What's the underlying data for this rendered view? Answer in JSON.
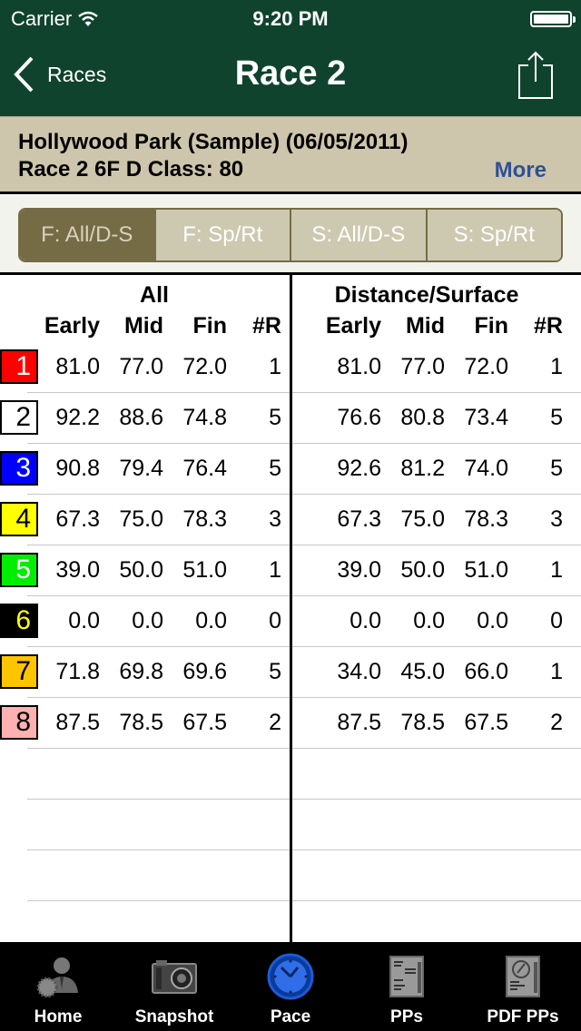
{
  "status_bar": {
    "carrier": "Carrier",
    "time": "9:20 PM"
  },
  "nav": {
    "back_label": "Races",
    "title": "Race 2"
  },
  "race_info": {
    "line1": "Hollywood Park (Sample) (06/05/2011)",
    "line2": "Race 2 6F D Class: 80",
    "more_label": "More"
  },
  "segments": [
    {
      "label": "F: All/D-S",
      "active": true
    },
    {
      "label": "F: Sp/Rt",
      "active": false
    },
    {
      "label": "S: All/D-S",
      "active": false
    },
    {
      "label": "S: Sp/Rt",
      "active": false
    }
  ],
  "table": {
    "groups": {
      "all": "All",
      "ds": "Distance/Surface"
    },
    "columns": [
      "Early",
      "Mid",
      "Fin",
      "#R"
    ],
    "rows": [
      {
        "pgm": "1",
        "bg": "#ff0000",
        "fg": "#ffffff",
        "all": [
          "81.0",
          "77.0",
          "72.0",
          "1"
        ],
        "ds": [
          "81.0",
          "77.0",
          "72.0",
          "1"
        ]
      },
      {
        "pgm": "2",
        "bg": "#ffffff",
        "fg": "#000000",
        "all": [
          "92.2",
          "88.6",
          "74.8",
          "5"
        ],
        "ds": [
          "76.6",
          "80.8",
          "73.4",
          "5"
        ]
      },
      {
        "pgm": "3",
        "bg": "#0000ff",
        "fg": "#ffffff",
        "all": [
          "90.8",
          "79.4",
          "76.4",
          "5"
        ],
        "ds": [
          "92.6",
          "81.2",
          "74.0",
          "5"
        ]
      },
      {
        "pgm": "4",
        "bg": "#ffff00",
        "fg": "#000000",
        "all": [
          "67.3",
          "75.0",
          "78.3",
          "3"
        ],
        "ds": [
          "67.3",
          "75.0",
          "78.3",
          "3"
        ]
      },
      {
        "pgm": "5",
        "bg": "#00ee00",
        "fg": "#ffffff",
        "all": [
          "39.0",
          "50.0",
          "51.0",
          "1"
        ],
        "ds": [
          "39.0",
          "50.0",
          "51.0",
          "1"
        ]
      },
      {
        "pgm": "6",
        "bg": "#000000",
        "fg": "#ffff00",
        "all": [
          "0.0",
          "0.0",
          "0.0",
          "0"
        ],
        "ds": [
          "0.0",
          "0.0",
          "0.0",
          "0"
        ]
      },
      {
        "pgm": "7",
        "bg": "#ffc400",
        "fg": "#000000",
        "all": [
          "71.8",
          "69.8",
          "69.6",
          "5"
        ],
        "ds": [
          "34.0",
          "45.0",
          "66.0",
          "1"
        ]
      },
      {
        "pgm": "8",
        "bg": "#ffb0b0",
        "fg": "#000000",
        "all": [
          "87.5",
          "78.5",
          "67.5",
          "2"
        ],
        "ds": [
          "87.5",
          "78.5",
          "67.5",
          "2"
        ]
      }
    ]
  },
  "tabbar": [
    {
      "label": "Home",
      "icon": "home-user-icon",
      "active": false
    },
    {
      "label": "Snapshot",
      "icon": "camera-icon",
      "active": false
    },
    {
      "label": "Pace",
      "icon": "clock-icon",
      "active": true
    },
    {
      "label": "PPs",
      "icon": "document-icon",
      "active": false
    },
    {
      "label": "PDF PPs",
      "icon": "pdf-document-icon",
      "active": false
    }
  ],
  "colors": {
    "nav_bg": "#0f432e",
    "header_bg": "#cdc6ac",
    "segment_active": "#756c46",
    "segment_inactive": "#cdc9b0",
    "link": "#2f5196"
  }
}
